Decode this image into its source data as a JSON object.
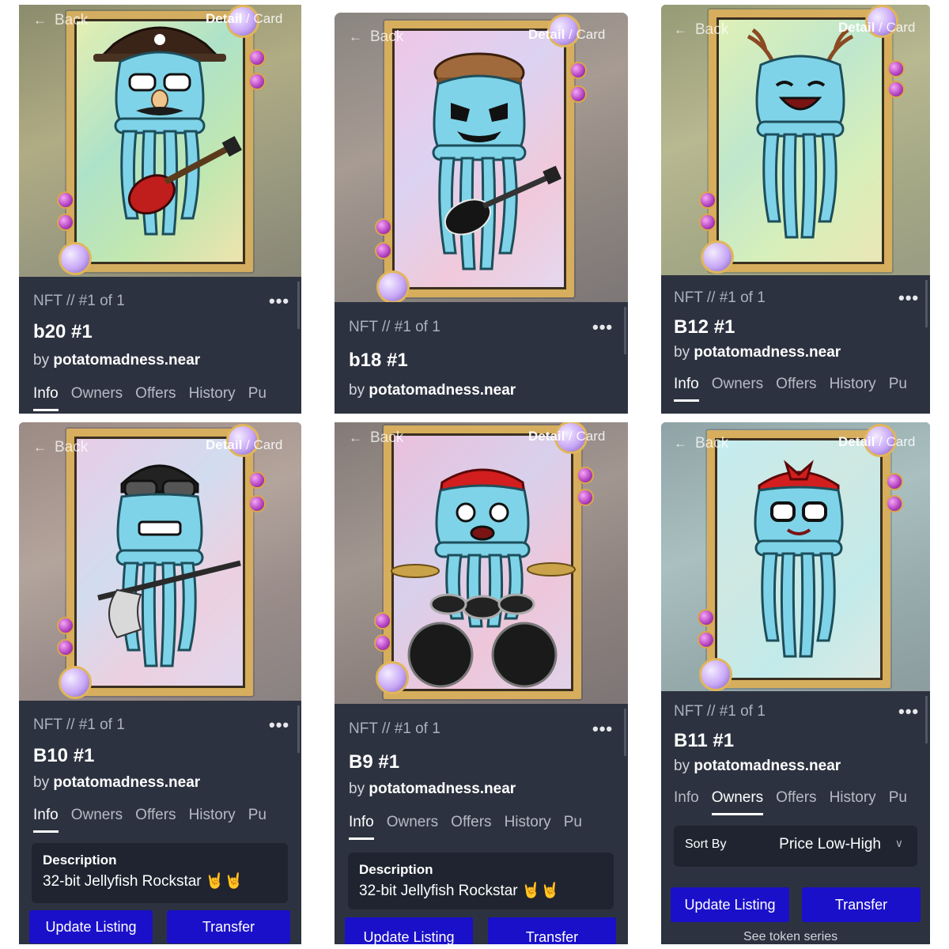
{
  "common": {
    "back_label": "Back",
    "toggle_detail": "Detail",
    "toggle_sep": "/",
    "toggle_card": "Card",
    "meta": "NFT // #1 of 1",
    "more": "•••",
    "by_prefix": "by",
    "creator": "potatomadness.near",
    "tabs": [
      "Info",
      "Owners",
      "Offers",
      "History",
      "Pu"
    ],
    "description_heading": "Description",
    "description_text": "32-bit Jellyfish Rockstar 🤘🤘",
    "update_listing": "Update Listing",
    "transfer": "Transfer",
    "sort_by_label": "Sort By",
    "sort_by_value": "Price Low-High",
    "see_series": "See token series"
  },
  "panels": [
    {
      "title": "b20 #1",
      "active_tab": "Info",
      "accessory": "pirate hat, glasses, mustache, red guitar",
      "colors": {
        "bg": "#9a9a78",
        "card": "#b5dfb0"
      }
    },
    {
      "title": "b18 #1",
      "active_tab": "",
      "accessory": "flat cap, skull face, black guitar",
      "colors": {
        "bg": "#8f8880",
        "card": "#e8c2de"
      }
    },
    {
      "title": "B12 #1",
      "active_tab": "Info",
      "accessory": "antlers, laughing face",
      "colors": {
        "bg": "#a4a87e",
        "card": "#cde6b5"
      }
    },
    {
      "title": "B10 #1",
      "active_tab": "Info",
      "accessory": "helmet with goggles, axe bass",
      "colors": {
        "bg": "#9b8c86",
        "card": "#dccbe2"
      }
    },
    {
      "title": "B9 #1",
      "active_tab": "Info",
      "accessory": "red bandana, drum kit",
      "colors": {
        "bg": "#8a7f7a",
        "card": "#e0bfd8"
      }
    },
    {
      "title": "B11 #1",
      "active_tab": "Owners",
      "accessory": "red bow, glasses",
      "colors": {
        "bg": "#93a6a8",
        "card": "#bfe6e4"
      }
    }
  ]
}
